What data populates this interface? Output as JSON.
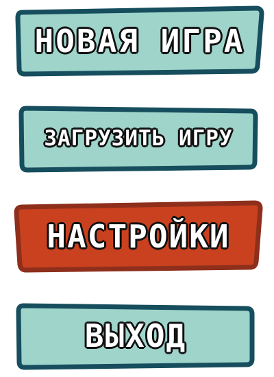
{
  "menu": {
    "buttons": [
      {
        "label": "НОВАЯ ИГРА",
        "fill": "#9fd4cb",
        "stroke": "#174e5e"
      },
      {
        "label": "ЗАГРУЗИТЬ ИГРУ",
        "fill": "#9fd4cb",
        "stroke": "#174e5e"
      },
      {
        "label": "НАСТРОЙКИ",
        "fill": "#c9411f",
        "stroke": "#8e2f1c"
      },
      {
        "label": "ВЫХОД",
        "fill": "#9fd4cb",
        "stroke": "#174e5e"
      }
    ]
  }
}
